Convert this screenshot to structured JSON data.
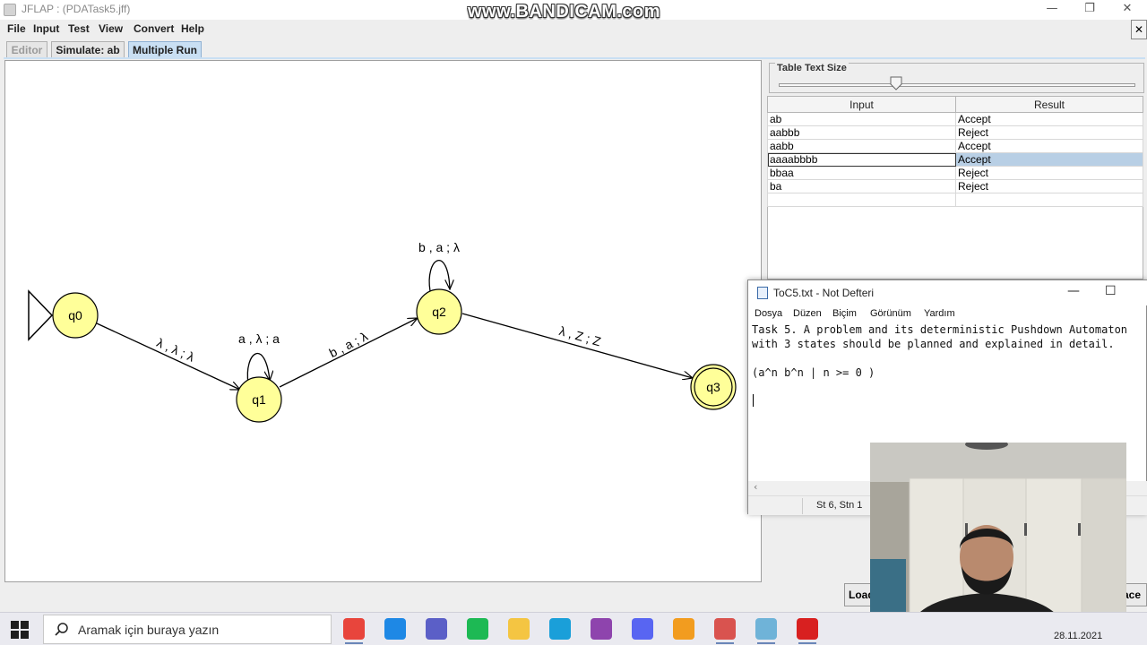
{
  "window": {
    "title": "JFLAP : (PDATask5.jff)",
    "watermark": "www.BANDICAM.com",
    "minimize_glyph": "—",
    "maximize_glyph": "❐",
    "close_glyph": "✕",
    "menu_close_glyph": "✕"
  },
  "menu": {
    "items": [
      "File",
      "Input",
      "Test",
      "View",
      "Convert",
      "Help"
    ]
  },
  "tabs": {
    "items": [
      "Editor",
      "Simulate: ab",
      "Multiple Run"
    ],
    "active": "Multiple Run",
    "disabled": "Editor"
  },
  "automaton": {
    "states": [
      {
        "id": "q0",
        "label": "q0",
        "initial": true,
        "final": false
      },
      {
        "id": "q1",
        "label": "q1",
        "initial": false,
        "final": false
      },
      {
        "id": "q2",
        "label": "q2",
        "initial": false,
        "final": false
      },
      {
        "id": "q3",
        "label": "q3",
        "initial": false,
        "final": true
      }
    ],
    "transitions": [
      {
        "from": "q0",
        "to": "q1",
        "label": "λ , λ ; λ"
      },
      {
        "from": "q1",
        "to": "q1",
        "label": "a , λ ; a"
      },
      {
        "from": "q1",
        "to": "q2",
        "label": "b , a ; λ"
      },
      {
        "from": "q2",
        "to": "q2",
        "label": "b , a ; λ"
      },
      {
        "from": "q2",
        "to": "q3",
        "label": "λ , Z ; Z"
      }
    ],
    "state_fill": "#ffff99",
    "state_stroke": "#000000"
  },
  "right_panel": {
    "table_text_size_label": "Table Text Size",
    "slider_value_fraction": 0.33,
    "columns": [
      "Input",
      "Result"
    ],
    "rows": [
      {
        "input": "ab",
        "result": "Accept",
        "selected": false
      },
      {
        "input": "aabbb",
        "result": "Reject",
        "selected": false
      },
      {
        "input": "aabb",
        "result": "Accept",
        "selected": false
      },
      {
        "input": "aaaabbbb",
        "result": "Accept",
        "selected": true
      },
      {
        "input": "bbaa",
        "result": "Reject",
        "selected": false
      },
      {
        "input": "ba",
        "result": "Reject",
        "selected": false
      },
      {
        "input": "",
        "result": "",
        "selected": false
      }
    ],
    "load_button": "Load",
    "partial_button": "ace"
  },
  "notepad": {
    "title": "ToC5.txt - Not Defteri",
    "minimize_glyph": "—",
    "maximize_glyph": "☐",
    "menu": [
      "Dosya",
      "Düzen",
      "Biçim",
      "Görünüm",
      "Yardım"
    ],
    "lines": [
      "Task 5. A problem and its deterministic Pushdown Automaton",
      "with 3 states should be planned and explained in detail.",
      "",
      "(a^n b^n | n >= 0 )"
    ],
    "status_position": "St 6, Stn 1",
    "scroll_left_glyph": "‹"
  },
  "taskbar": {
    "search_placeholder": "Aramak için buraya yazın",
    "apps": [
      {
        "name": "chrome-icon",
        "color": "#e8453c",
        "open": true
      },
      {
        "name": "vscode-icon",
        "color": "#1e88e5",
        "open": false
      },
      {
        "name": "teams-icon",
        "color": "#5b5fc7",
        "open": false
      },
      {
        "name": "spotify-icon",
        "color": "#1db954",
        "open": false
      },
      {
        "name": "file-explorer-icon",
        "color": "#f4c542",
        "open": false
      },
      {
        "name": "edge-icon",
        "color": "#1a9fd9",
        "open": false
      },
      {
        "name": "visual-studio-icon",
        "color": "#8e44ad",
        "open": false
      },
      {
        "name": "discord-icon",
        "color": "#5865f2",
        "open": false
      },
      {
        "name": "sublime-icon",
        "color": "#f29c1f",
        "open": false
      },
      {
        "name": "java-icon",
        "color": "#d9534f",
        "open": true
      },
      {
        "name": "notepad-icon",
        "color": "#6fb3d8",
        "open": true
      },
      {
        "name": "bandicam-icon",
        "color": "#d82020",
        "open": true
      }
    ],
    "date": "28.11.2021"
  }
}
